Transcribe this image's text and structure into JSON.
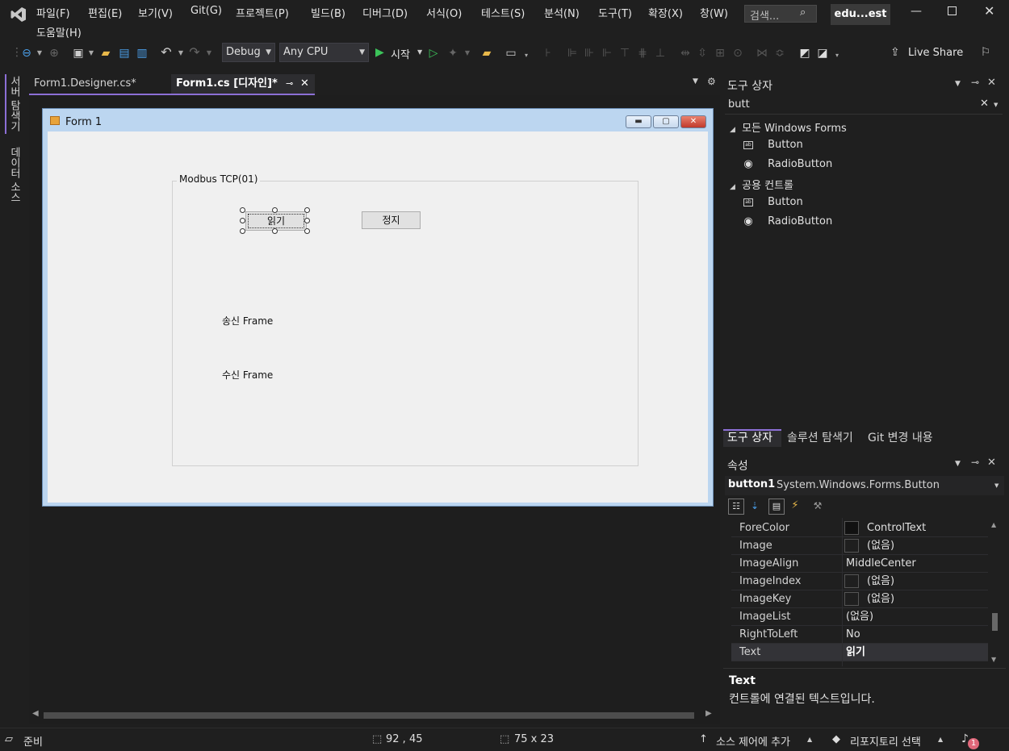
{
  "menu": {
    "items": [
      "파일(F)",
      "편집(E)",
      "보기(V)",
      "Git(G)",
      "프로젝트(P)",
      "빌드(B)",
      "디버그(D)",
      "서식(O)",
      "테스트(S)",
      "분석(N)",
      "도구(T)",
      "확장(X)",
      "창(W)"
    ],
    "help": "도움말(H)",
    "search_placeholder": "검색...",
    "window_title": "edu...est"
  },
  "toolbar": {
    "config": "Debug",
    "platform": "Any CPU",
    "start_label": "시작",
    "live_share": "Live Share"
  },
  "left_strip": {
    "server_explorer": "서버 탐색기",
    "data_sources": "데이터 소스"
  },
  "tabs": [
    {
      "label": "Form1.Designer.cs*"
    },
    {
      "label": "Form1.cs [디자인]*"
    }
  ],
  "form": {
    "title": "Form 1",
    "group_label": "Modbus TCP(01)",
    "read_button": "읽기",
    "stop_button": "정지",
    "send_label": "송신 Frame",
    "recv_label": "수신 Frame"
  },
  "toolbox": {
    "title": "도구 상자",
    "search_value": "butt",
    "groups": [
      {
        "name": "모든 Windows Forms",
        "items": [
          "Button",
          "RadioButton"
        ]
      },
      {
        "name": "공용 컨트롤",
        "items": [
          "Button",
          "RadioButton"
        ]
      }
    ],
    "bottom_tabs": [
      "도구 상자",
      "솔루션 탐색기",
      "Git 변경 내용"
    ]
  },
  "properties": {
    "title": "속성",
    "object_name": "button1",
    "object_type": "System.Windows.Forms.Button",
    "rows": [
      {
        "name": "ForeColor",
        "value": "ControlText"
      },
      {
        "name": "Image",
        "value": "(없음)"
      },
      {
        "name": "ImageAlign",
        "value": "MiddleCenter"
      },
      {
        "name": "ImageIndex",
        "value": "(없음)"
      },
      {
        "name": "ImageKey",
        "value": "(없음)"
      },
      {
        "name": "ImageList",
        "value": "(없음)"
      },
      {
        "name": "RightToLeft",
        "value": "No"
      },
      {
        "name": "Text",
        "value": "읽기"
      }
    ],
    "desc_title": "Text",
    "desc_text": "컨트롤에 연결된 텍스트입니다."
  },
  "status": {
    "ready": "준비",
    "position": "92 , 45",
    "size": "75 x 23",
    "source_control": "소스 제어에 추가",
    "repository": "리포지토리 선택",
    "notifications": "1"
  },
  "colors": {
    "accent": "#8c6fd6",
    "background": "#1f1f1f",
    "form_client": "#f0f0f0",
    "play_green": "#3cc45a"
  }
}
